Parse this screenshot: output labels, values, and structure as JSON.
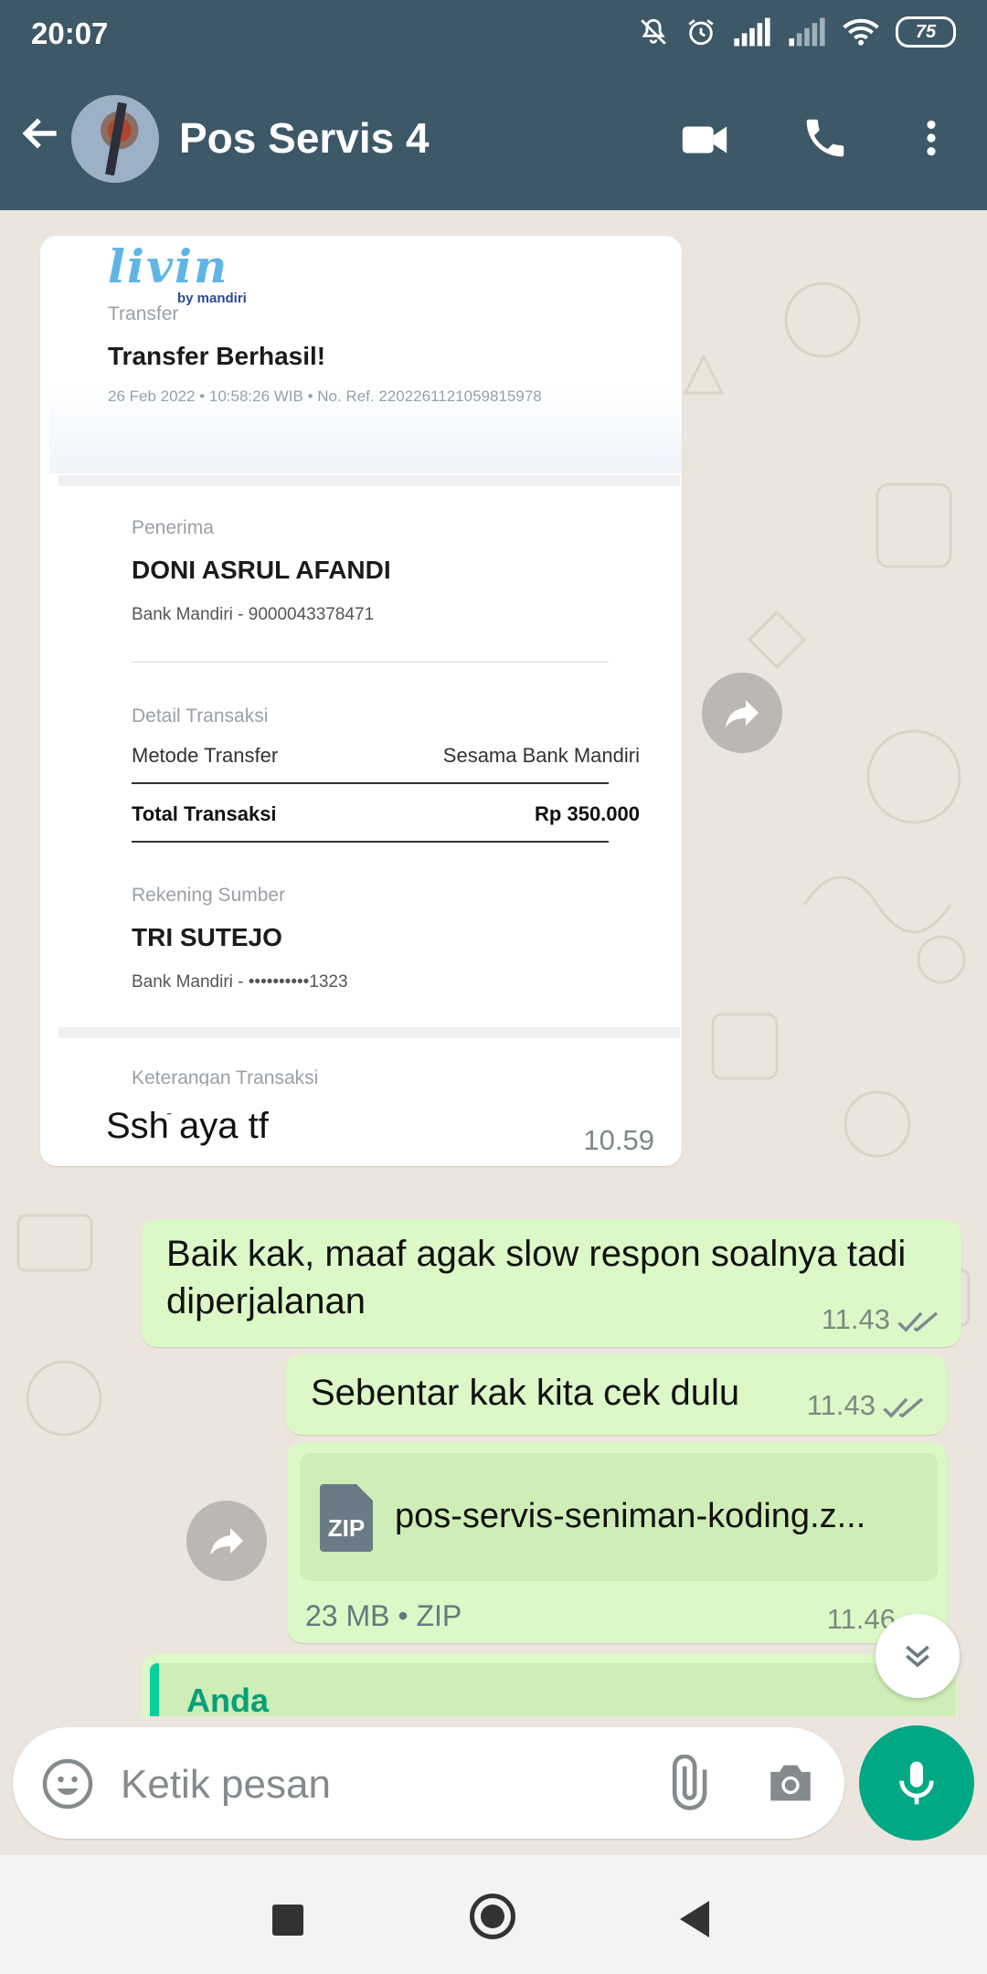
{
  "status_bar": {
    "time": "20:07",
    "battery": "75"
  },
  "header": {
    "title": "Pos Servis 4"
  },
  "receipt": {
    "logo_text": "livin",
    "logo_sub": "by mandiri",
    "category": "Transfer",
    "headline": "Transfer Berhasil!",
    "meta": "26 Feb 2022 • 10:58:26 WIB • No. Ref. 2202261121059815978",
    "recipient_label": "Penerima",
    "recipient_name": "DONI ASRUL AFANDI",
    "recipient_account": "Bank Mandiri - 9000043378471",
    "detail_label": "Detail Transaksi",
    "method_label": "Metode Transfer",
    "method_value": "Sesama Bank Mandiri",
    "total_label": "Total Transaksi",
    "total_value": "Rp 350.000",
    "source_label": "Rekening Sumber",
    "source_name": "TRI SUTEJO",
    "source_account": "Bank Mandiri - ••••••••••1323",
    "note_label": "Keterangan Transaksi",
    "note_value": "-"
  },
  "messages": [
    {
      "direction": "in",
      "text": "Ssh aya tf",
      "time": "10.59"
    },
    {
      "direction": "out",
      "text": "Baik kak, maaf agak slow respon soalnya tadi diperjalanan",
      "time": "11.43"
    },
    {
      "direction": "out",
      "text": "Sebentar kak kita cek dulu",
      "time": "11.43"
    },
    {
      "direction": "out",
      "type": "file",
      "file_icon": "ZIP",
      "file_name": "pos-servis-seniman-koding.z...",
      "file_meta": "23 MB • ZIP",
      "time": "11.46"
    },
    {
      "direction": "out",
      "type": "reply",
      "quote_author": "Anda"
    }
  ],
  "composer": {
    "placeholder": "Ketik pesan"
  },
  "icons": {
    "back": "arrow-left-icon",
    "video": "video-camera-icon",
    "call": "phone-icon",
    "menu": "more-vertical-icon",
    "emoji": "emoji-icon",
    "attach": "paperclip-icon",
    "camera": "camera-icon",
    "mic": "microphone-icon",
    "forward": "forward-icon",
    "scroll": "chevron-double-down-icon"
  },
  "colors": {
    "header": "#3d5866",
    "outgoing": "#dcf8c6",
    "incoming": "#ffffff",
    "accent": "#00a884",
    "wallpaper": "#ece5dd"
  }
}
